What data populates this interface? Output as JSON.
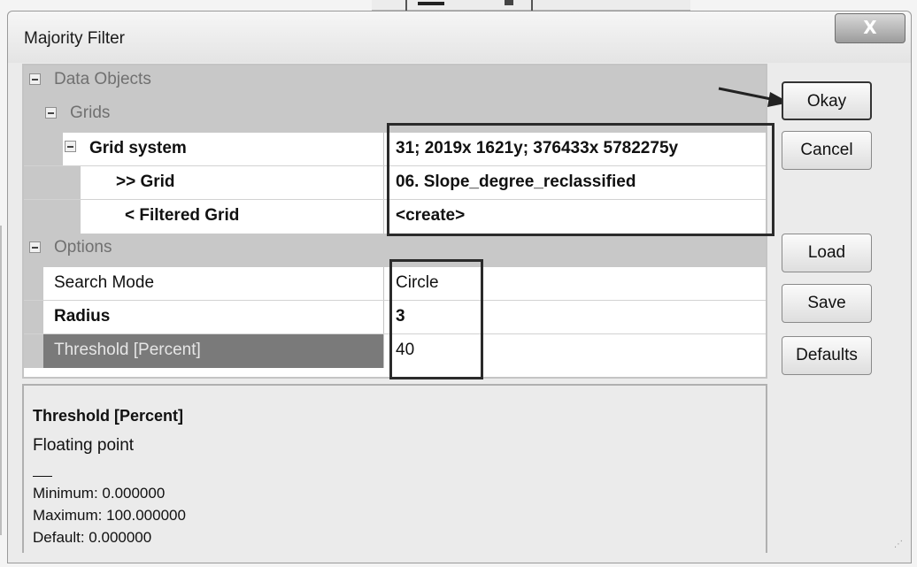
{
  "window": {
    "title": "Majority Filter",
    "close_label": "X"
  },
  "parameters": {
    "data_objects_label": "Data Objects",
    "grids_label": "Grids",
    "grid_system": {
      "name": "Grid system",
      "value": "31; 2019x 1621y; 376433x 5782275y"
    },
    "grid_input": {
      "name": ">> Grid",
      "value": "06. Slope_degree_reclassified"
    },
    "filtered_grid": {
      "name": "< Filtered Grid",
      "value": "<create>"
    },
    "options_label": "Options",
    "search_mode": {
      "name": "Search Mode",
      "value": "Circle"
    },
    "radius": {
      "name": "Radius",
      "value": "3"
    },
    "threshold": {
      "name": "Threshold [Percent]",
      "value": "40"
    }
  },
  "description": {
    "title": "Threshold [Percent]",
    "type": "Floating point",
    "minimum": "Minimum: 0.000000",
    "maximum": "Maximum: 100.000000",
    "default": "Default: 0.000000"
  },
  "buttons": {
    "okay": "Okay",
    "cancel": "Cancel",
    "load": "Load",
    "save": "Save",
    "defaults": "Defaults"
  },
  "icons": {
    "collapse": "collapse-icon",
    "arrow": "arrow-annotation-icon",
    "close": "close-icon"
  },
  "colors": {
    "category_row": "#c8c8c8",
    "selected_row": "#7a7a7a",
    "annotation": "#2b2b2b"
  }
}
